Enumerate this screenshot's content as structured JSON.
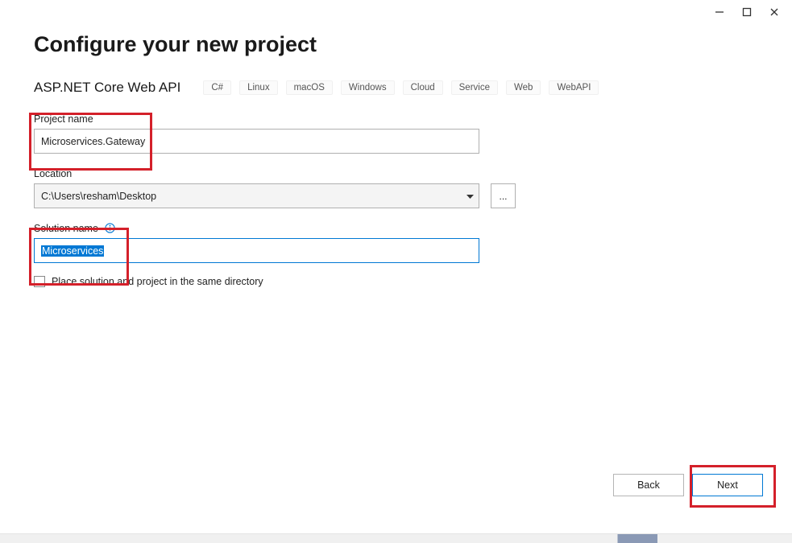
{
  "titlebar": {
    "minimize": "−",
    "maximize": "☐",
    "close": "✕"
  },
  "heading": "Configure your new project",
  "template": {
    "name": "ASP.NET Core Web API",
    "tags": [
      "C#",
      "Linux",
      "macOS",
      "Windows",
      "Cloud",
      "Service",
      "Web",
      "WebAPI"
    ]
  },
  "fields": {
    "projectName": {
      "label": "Project name",
      "value": "Microservices.Gateway"
    },
    "location": {
      "label": "Location",
      "value": "C:\\Users\\resham\\Desktop",
      "browse": "..."
    },
    "solutionName": {
      "label": "Solution name",
      "value": "Microservices",
      "selected": true
    }
  },
  "checkbox": {
    "label": "Place solution and project in the same directory",
    "checked": false
  },
  "buttons": {
    "back": "Back",
    "next": "Next"
  }
}
